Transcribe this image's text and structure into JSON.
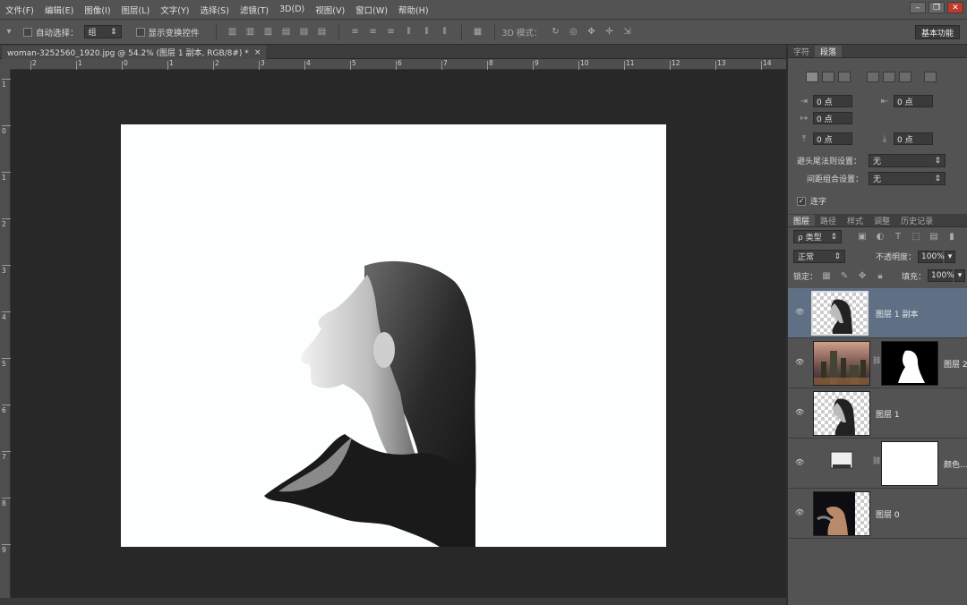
{
  "menu": [
    "文件(F)",
    "编辑(E)",
    "图像(I)",
    "图层(L)",
    "文字(Y)",
    "选择(S)",
    "滤镜(T)",
    "3D(D)",
    "视图(V)",
    "窗口(W)",
    "帮助(H)"
  ],
  "options": {
    "auto_select_label": "自动选择：",
    "auto_select_value": "组",
    "show_transform_label": "显示变换控件",
    "mode3d_label": "3D 模式：",
    "workspace_button": "基本功能"
  },
  "document_tab": {
    "title": "woman-3252560_1920.jpg @ 54.2% (图层 1 副本, RGB/8#) *",
    "close": "×"
  },
  "ruler_h": [
    "2",
    "1",
    "0",
    "1",
    "2",
    "3",
    "4",
    "5",
    "6",
    "7",
    "8",
    "9",
    "10",
    "11",
    "12",
    "13",
    "14"
  ],
  "ruler_v": [
    "1",
    "0",
    "1",
    "2",
    "3",
    "4",
    "5",
    "6",
    "7",
    "8",
    "9"
  ],
  "char_panel": {
    "tabs": [
      "字符",
      "段落"
    ],
    "active_tab": "段落",
    "indent_left": "0 点",
    "indent_right": "0 点",
    "indent_first": "0 点",
    "space_before": "0 点",
    "space_after": "0 点",
    "kinsoku_label": "避头尾法则设置：",
    "kinsoku_value": "无",
    "mojikumi_label": "间距组合设置：",
    "mojikumi_value": "无",
    "hyphenate_label": "连字"
  },
  "layers_panel": {
    "tabs": [
      "图层",
      "路径",
      "样式",
      "调整",
      "历史记录"
    ],
    "filter_label": "ρ 类型",
    "blend_mode": "正常",
    "opacity_label": "不透明度：",
    "opacity_value": "100%",
    "lock_label": "锁定：",
    "fill_label": "填充：",
    "fill_value": "100%",
    "layers": [
      {
        "name": "图层 1 副本",
        "selected": true
      },
      {
        "name": "图层 2",
        "selected": false
      },
      {
        "name": "图层 1",
        "selected": false
      },
      {
        "name": "颜色...",
        "selected": false
      },
      {
        "name": "图层 0",
        "selected": false
      }
    ]
  }
}
